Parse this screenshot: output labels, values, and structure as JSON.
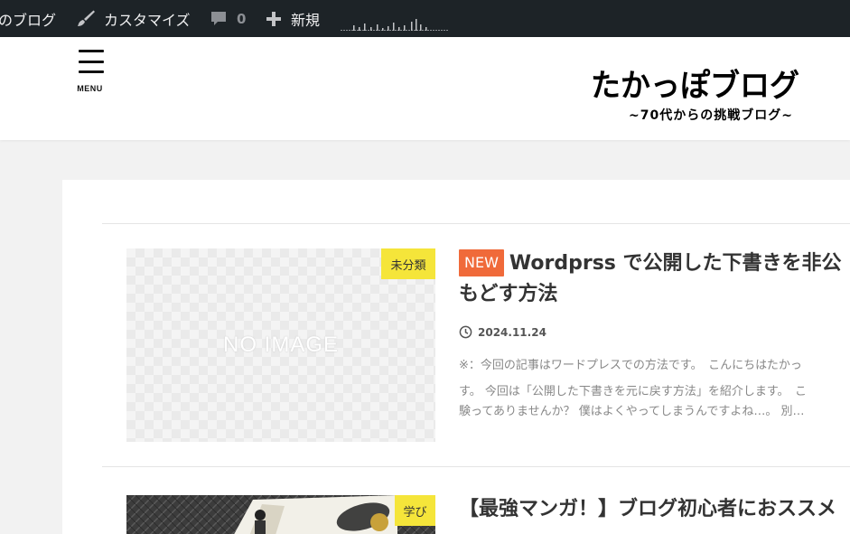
{
  "admin_bar": {
    "site_name": "のブログ",
    "customize": "カスタマイズ",
    "comments_count": "0",
    "new_label": "新規"
  },
  "header": {
    "menu_label": "MENU",
    "logo_title": "たかっぽブログ",
    "logo_subtitle": "~70代からの挑戦ブログ~"
  },
  "posts": [
    {
      "category": "未分類",
      "thumbnail_text": "NO IMAGE",
      "badge": "NEW",
      "title_line1": "Wordprss で公開した下書きを非公",
      "title_line2": "もどす方法",
      "date": "2024.11.24",
      "excerpt_lines": [
        "※：今回の記事はワードプレスでの方法です。　こんにちはたかっ",
        "す。 今回は「公開した下書きを元に戻す方法」を紹介します。　こ",
        "験ってありませんか？ 僕はよくやってしまうんですよね…。 別…"
      ]
    },
    {
      "category": "学び",
      "title_line1": "【最強マンガ！】ブログ初心者におススメ"
    }
  ],
  "colors": {
    "admin_bar_bg": "#1d2327",
    "new_badge": "#f06a3a",
    "category_badge": "#f5e53a"
  },
  "icons": [
    "brush-icon",
    "comment-icon",
    "plus-icon",
    "stats-sparkline-icon",
    "hamburger-menu-icon",
    "clock-icon"
  ]
}
